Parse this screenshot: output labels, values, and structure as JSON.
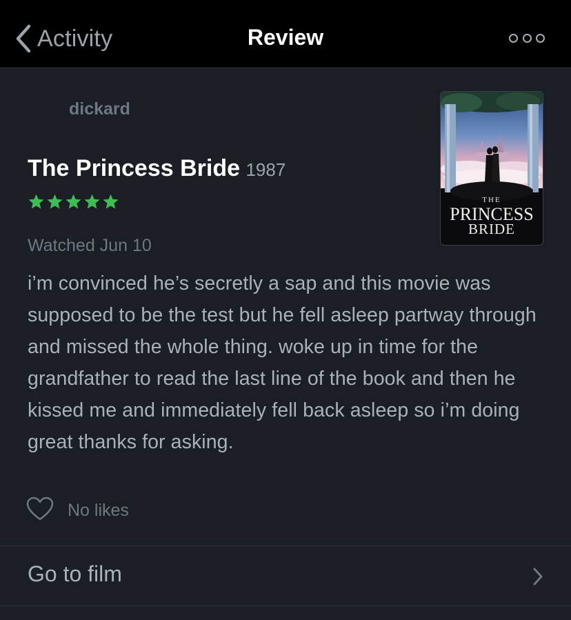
{
  "navbar": {
    "back_label": "Activity",
    "title": "Review",
    "back_icon": "chevron-left-icon",
    "more_icon": "more-dots-icon"
  },
  "review": {
    "author": "dickard",
    "film_title": "The Princess Bride",
    "film_year": "1987",
    "rating_stars": 5,
    "watched": "Watched Jun 10",
    "body": "i’m convinced he’s secretly a sap and this movie was supposed to be the test but he fell asleep partway through and missed the whole thing. woke up in time for the grandfather to read the last line of the book and then he kissed me and immediately fell back asleep so i’m doing great thanks for asking.",
    "likes_label": "No likes",
    "poster_text": [
      "THE",
      "PRINCESS",
      "BRIDE"
    ]
  },
  "footer": {
    "goto_label": "Go to film"
  },
  "colors": {
    "background": "#1b1e24",
    "navbar": "#000000",
    "star": "#40bc56",
    "text_primary": "#ffffff",
    "text_secondary": "#a9b2ba",
    "text_muted": "#6e7882"
  }
}
